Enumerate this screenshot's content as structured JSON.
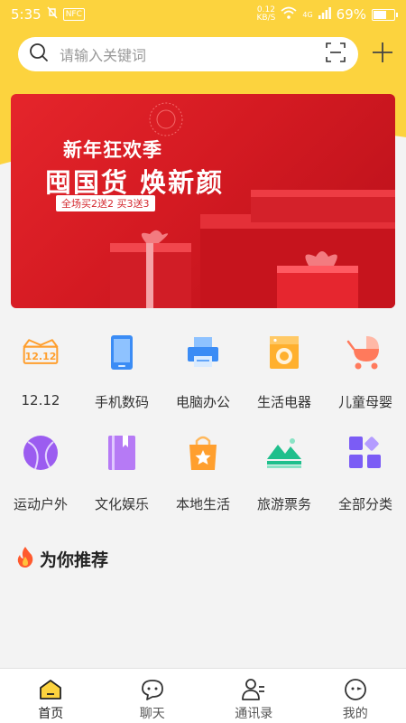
{
  "status_bar": {
    "time": "5:35",
    "nfc": "NFC",
    "speed": "0.12",
    "speed_unit": "KB/S",
    "network": "4G",
    "battery": "69%",
    "battery_level": 0.69
  },
  "search": {
    "placeholder": "请输入关键词"
  },
  "banner": {
    "line1": "新年狂欢季",
    "line2": "囤国货 焕新颜",
    "tag": "全场买2送2 买3送3"
  },
  "categories_row1": [
    {
      "label": "12.12",
      "icon": "calendar-1212-icon"
    },
    {
      "label": "手机数码",
      "icon": "phone-icon"
    },
    {
      "label": "电脑办公",
      "icon": "printer-icon"
    },
    {
      "label": "生活电器",
      "icon": "washing-machine-icon"
    },
    {
      "label": "儿童母婴",
      "icon": "stroller-icon"
    }
  ],
  "categories_row2": [
    {
      "label": "运动户外",
      "icon": "ball-icon"
    },
    {
      "label": "文化娱乐",
      "icon": "book-icon"
    },
    {
      "label": "本地生活",
      "icon": "shopping-bag-icon"
    },
    {
      "label": "旅游票务",
      "icon": "mountain-icon"
    },
    {
      "label": "全部分类",
      "icon": "all-categories-icon"
    }
  ],
  "recommend": {
    "title": "为你推荐"
  },
  "tabbar": [
    {
      "label": "首页",
      "icon": "home-icon",
      "active": true
    },
    {
      "label": "聊天",
      "icon": "chat-icon",
      "active": false
    },
    {
      "label": "通讯录",
      "icon": "contacts-icon",
      "active": false
    },
    {
      "label": "我的",
      "icon": "profile-icon",
      "active": false
    }
  ],
  "colors": {
    "accent": "#fcd33e",
    "banner_red": "#d41a22",
    "orange": "#ff9f2e",
    "blue": "#3b8cf5",
    "purple": "#9b5cf0",
    "green": "#1fbf8c"
  }
}
